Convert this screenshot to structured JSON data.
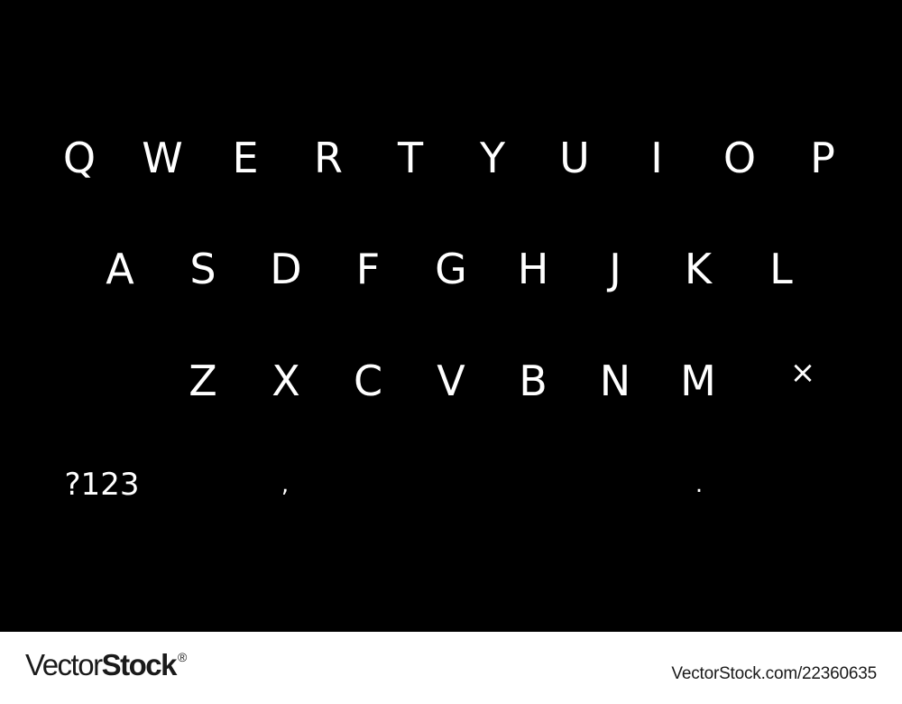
{
  "keyboard": {
    "background": "#000000",
    "key_color": "#ffffff",
    "row1": [
      "Q",
      "W",
      "E",
      "R",
      "T",
      "Y",
      "U",
      "I",
      "O",
      "P"
    ],
    "row2": [
      "A",
      "S",
      "D",
      "F",
      "G",
      "H",
      "J",
      "K",
      "L"
    ],
    "row3": [
      "Z",
      "X",
      "C",
      "V",
      "B",
      "N",
      "M"
    ],
    "delete_key": "×",
    "bottom": {
      "symbols": "?123",
      "comma": ",",
      "period": "."
    }
  },
  "footer": {
    "brand_regular": "Vector",
    "brand_bold": "Stock",
    "brand_mark": "®",
    "image_id": "VectorStock.com/22360635"
  }
}
